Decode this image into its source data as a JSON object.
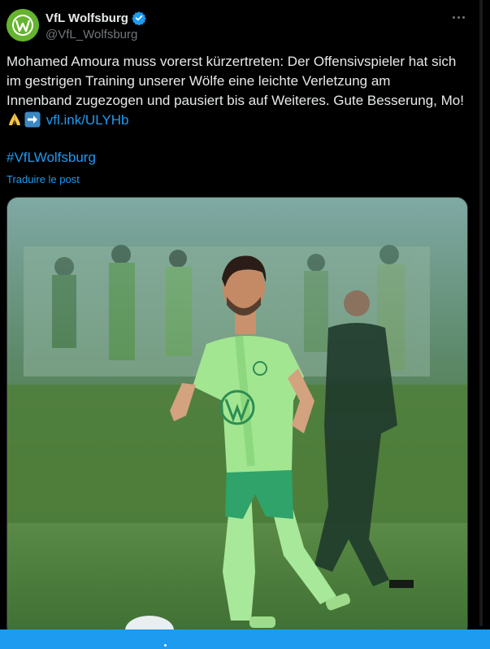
{
  "account": {
    "name": "VfL Wolfsburg",
    "handle": "@VfL_Wolfsburg",
    "verified": true
  },
  "tweet": {
    "line1": "Mohamed Amoura muss vorerst kürzertreten: Der Offensivspieler hat sich",
    "line2": "im gestrigen Training unserer Wölfe eine leichte Verletzung am",
    "line3": "Innenband zugezogen und pausiert bis auf Weiteres. Gute Besserung, Mo!",
    "link": "vfl.ink/ULYHb",
    "hashtag": "#VfLWolfsburg",
    "translate": "Traduire le post"
  },
  "icons": {
    "more": "more-dots-icon",
    "verified": "verified-badge-icon",
    "pray": "folded-hands-emoji",
    "arrow": "right-arrow-emoji"
  },
  "colors": {
    "background": "#000000",
    "text": "#e7e9ea",
    "secondary": "#71767b",
    "link": "#1d9bf0",
    "brand_green": "#65b32e"
  }
}
